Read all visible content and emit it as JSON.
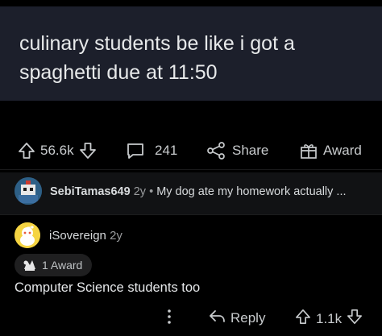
{
  "post": {
    "text": "culinary students be like i got a spaghetti due at 11:50"
  },
  "post_actions": {
    "upvotes": "56.6k",
    "comments": "241",
    "share_label": "Share",
    "award_label": "Award"
  },
  "top_reply": {
    "username": "SebiTamas649",
    "age": "2y",
    "separator": "•",
    "preview": "My dog ate my homework actually ..."
  },
  "comment": {
    "username": "iSovereign",
    "age": "2y",
    "award_count_label": "1 Award",
    "body": "Computer Science students too",
    "reply_label": "Reply",
    "votes": "1.1k"
  },
  "colors": {
    "background": "#000000",
    "tweet_bg": "#1c1f2b",
    "text": "#d7dadc",
    "muted": "#9a9c9e",
    "avatar_yellow": "#f5d442"
  },
  "icons": [
    "upvote-arrow-icon",
    "downvote-arrow-icon",
    "comment-bubble-icon",
    "share-icon",
    "gift-award-icon",
    "more-dots-icon",
    "reply-arrow-icon",
    "snoo-avatar-icon",
    "award-icon"
  ]
}
